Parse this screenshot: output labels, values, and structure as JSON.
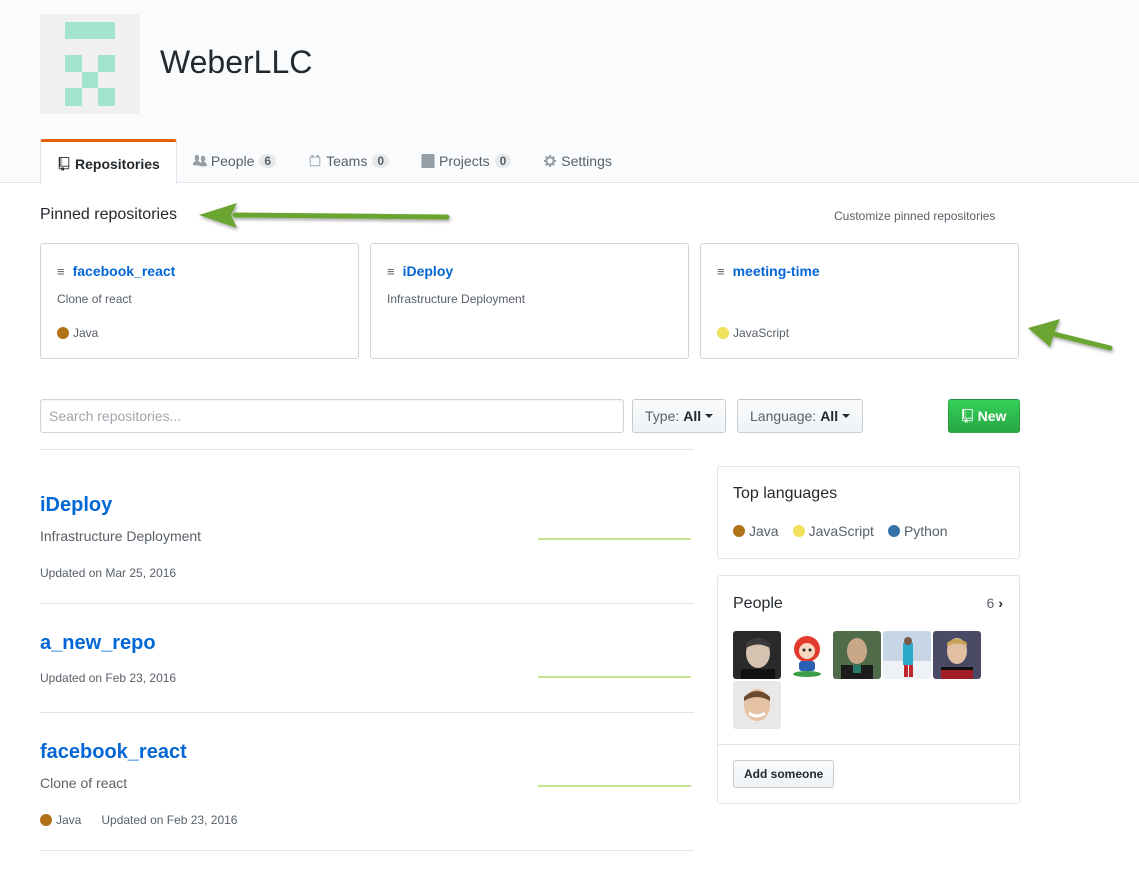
{
  "org": {
    "name": "WeberLLC"
  },
  "tabs": [
    {
      "label": "Repositories",
      "icon": "repo-icon",
      "count": null
    },
    {
      "label": "People",
      "icon": "people-icon",
      "count": "6"
    },
    {
      "label": "Teams",
      "icon": "teams-icon",
      "count": "0"
    },
    {
      "label": "Projects",
      "icon": "projects-icon",
      "count": "0"
    },
    {
      "label": "Settings",
      "icon": "gear-icon",
      "count": null
    }
  ],
  "pinned": {
    "title": "Pinned repositories",
    "customize": "Customize pinned repositories",
    "repos": [
      {
        "name": "facebook_react",
        "description": "Clone of react",
        "language": "Java",
        "color": "#b07219"
      },
      {
        "name": "iDeploy",
        "description": "Infrastructure Deployment",
        "language": "",
        "color": ""
      },
      {
        "name": "meeting-time",
        "description": "",
        "language": "JavaScript",
        "color": "#f1e05a"
      }
    ]
  },
  "filters": {
    "search_placeholder": "Search repositories...",
    "type_label": "Type:",
    "type_value": "All",
    "language_label": "Language:",
    "language_value": "All",
    "new_label": "New"
  },
  "repos": [
    {
      "name": "iDeploy",
      "description": "Infrastructure Deployment",
      "language": "",
      "updated": "Updated on Mar 25, 2016"
    },
    {
      "name": "a_new_repo",
      "description": "",
      "language": "",
      "updated": "Updated on Feb 23, 2016"
    },
    {
      "name": "facebook_react",
      "description": "Clone of react",
      "language": "Java",
      "updated": "Updated on Feb 23, 2016"
    }
  ],
  "top_languages": {
    "title": "Top languages",
    "items": [
      {
        "name": "Java",
        "color": "#b07219"
      },
      {
        "name": "JavaScript",
        "color": "#f1e05a"
      },
      {
        "name": "Python",
        "color": "#3572A5"
      }
    ]
  },
  "people": {
    "title": "People",
    "count": "6",
    "add_label": "Add someone"
  },
  "colors": {
    "accent": "#e36209",
    "link": "#0366d6",
    "new_button": "#28a745",
    "arrow": "#6aa533"
  }
}
